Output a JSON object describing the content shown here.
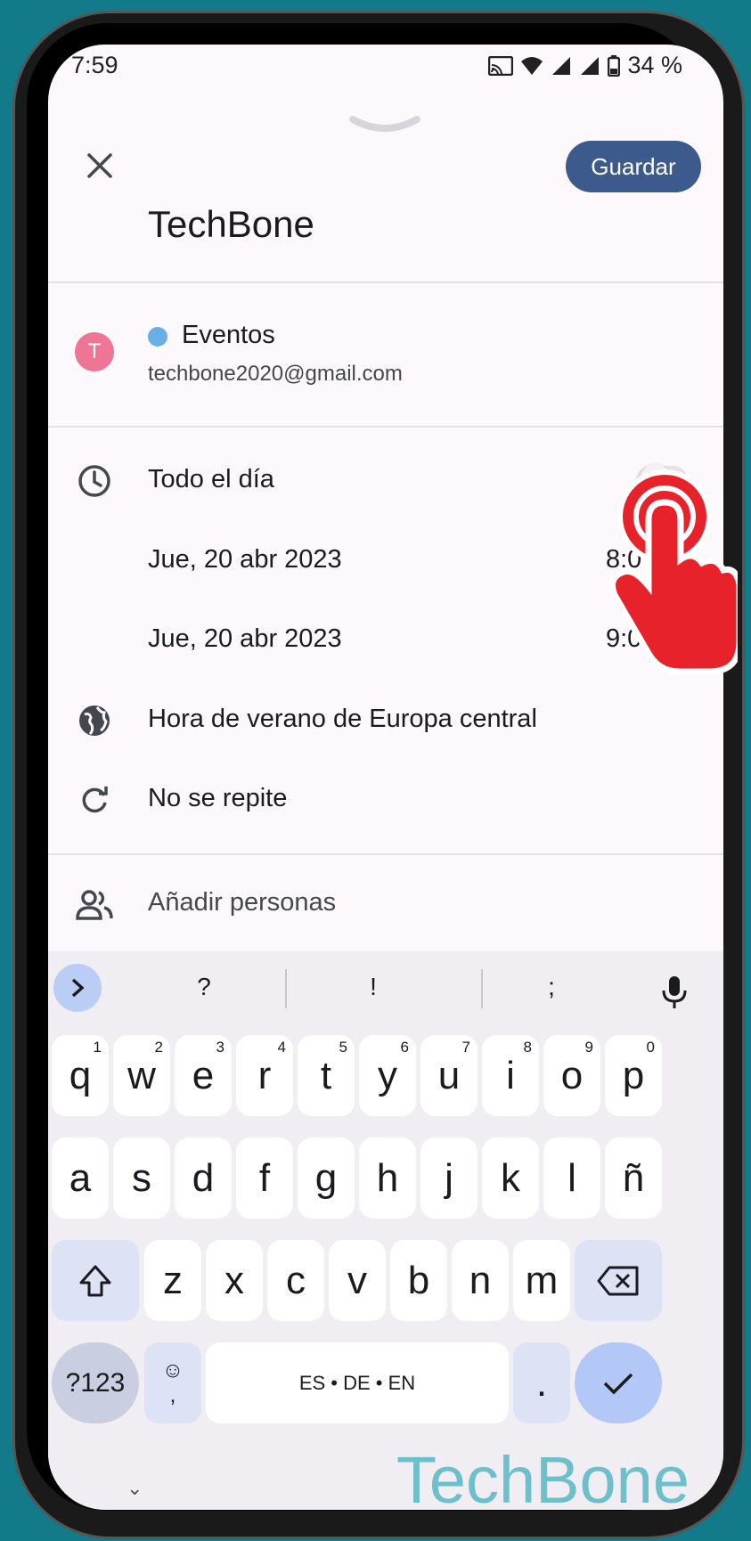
{
  "status_bar": {
    "time": "7:59",
    "battery": "34 %"
  },
  "header": {
    "save_label": "Guardar",
    "title": "TechBone"
  },
  "calendar": {
    "avatar_letter": "T",
    "name": "Eventos",
    "email": "techbone2020@gmail.com",
    "dot_color": "#6aaee8"
  },
  "event": {
    "all_day_label": "Todo el día",
    "all_day_on": false,
    "start_date": "Jue, 20 abr 2023",
    "start_time": "8:0",
    "end_date": "Jue, 20 abr 2023",
    "end_time": "9:0",
    "timezone": "Hora de verano de Europa central",
    "repeat": "No se repite",
    "add_people": "Añadir personas"
  },
  "keyboard": {
    "suggestions": [
      "?",
      "!",
      ";"
    ],
    "row1": [
      {
        "k": "q",
        "h": "1"
      },
      {
        "k": "w",
        "h": "2"
      },
      {
        "k": "e",
        "h": "3"
      },
      {
        "k": "r",
        "h": "4"
      },
      {
        "k": "t",
        "h": "5"
      },
      {
        "k": "y",
        "h": "6"
      },
      {
        "k": "u",
        "h": "7"
      },
      {
        "k": "i",
        "h": "8"
      },
      {
        "k": "o",
        "h": "9"
      },
      {
        "k": "p",
        "h": "0"
      }
    ],
    "row2": [
      "a",
      "s",
      "d",
      "f",
      "g",
      "h",
      "j",
      "k",
      "l",
      "ñ"
    ],
    "row3": [
      "z",
      "x",
      "c",
      "v",
      "b",
      "n",
      "m"
    ],
    "sym_label": "?123",
    "emoji_label": "☺",
    "comma_label": ",",
    "space_label": "ES • DE • EN",
    "period_label": "."
  },
  "watermark": "TechBone",
  "accent_color": "#3d5a8c"
}
